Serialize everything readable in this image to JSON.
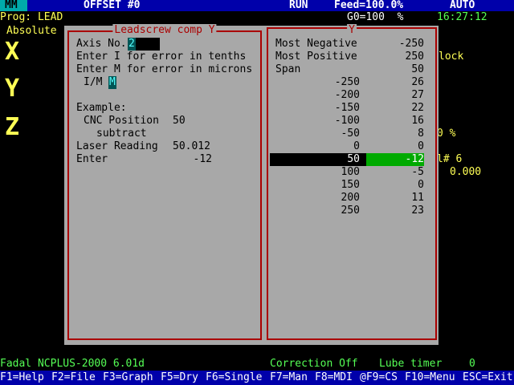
{
  "top_bar": {
    "units": "MM",
    "offset": "OFFSET #0",
    "run_state": "RUN",
    "feed": "Feed=100.0%",
    "mode": "AUTO"
  },
  "status_row": {
    "program": "Prog: LEAD",
    "g0": "G0=100  %",
    "clock": "16:27:12"
  },
  "left_panel": {
    "absolute_label": "Absolute",
    "axes": [
      "X",
      "Y",
      "Z"
    ]
  },
  "right_partial": {
    "lock": "lock",
    "zero_pct": "0 %",
    "tool_num": "l# 6",
    "tool_val": "0.000"
  },
  "dialog": {
    "title": "Leadscrew comp Y",
    "lines": {
      "axis_no_label": "Axis No.",
      "axis_no_value": "2",
      "enter_i": "Enter I for error in tenths",
      "enter_m": "Enter M for error in microns",
      "im_label": "I/M",
      "im_value": "M",
      "example": "Example:",
      "cnc_position_label": "CNC Position",
      "cnc_position_value": "50",
      "subtract": "subtract",
      "laser_reading_label": "Laser Reading",
      "laser_reading_value": "50.012",
      "enter_label": "Enter",
      "enter_value": "-12"
    }
  },
  "y_table": {
    "title": "Y",
    "summary": [
      {
        "label": "Most Negative",
        "value": "-250"
      },
      {
        "label": "Most Positive",
        "value": "250"
      },
      {
        "label": "Span",
        "value": "50"
      }
    ],
    "rows": [
      {
        "position": "-250",
        "error": "26"
      },
      {
        "position": "-200",
        "error": "27"
      },
      {
        "position": "-150",
        "error": "22"
      },
      {
        "position": "-100",
        "error": "16"
      },
      {
        "position": "-50",
        "error": "8"
      },
      {
        "position": "0",
        "error": "0"
      },
      {
        "position": "50",
        "error": "-12",
        "selected": true
      },
      {
        "position": "100",
        "error": "-5"
      },
      {
        "position": "150",
        "error": "0"
      },
      {
        "position": "200",
        "error": "11"
      },
      {
        "position": "250",
        "error": "23"
      }
    ]
  },
  "bottom_status": {
    "version": "Fadal NCPLUS-2000 6.01d",
    "correction": "Correction Off",
    "lube": "Lube timer",
    "lube_value": "0"
  },
  "function_keys": [
    "F1=Help",
    "F2=File",
    "F3=Graph",
    "F5=Dry",
    "F6=Single",
    "F7=Man",
    "F8=MDI",
    "@F9=CS",
    "F10=Menu",
    "ESC=Exit"
  ],
  "colors": {
    "top_bar_bg": "#0000aa",
    "mode_cell_bg": "#00aaaa",
    "dialog_bg": "#a8a8a8",
    "frame_red": "#aa0000",
    "highlight_green": "#00aa00",
    "axis_yellow": "#ffff55",
    "status_green": "#55ff55"
  }
}
